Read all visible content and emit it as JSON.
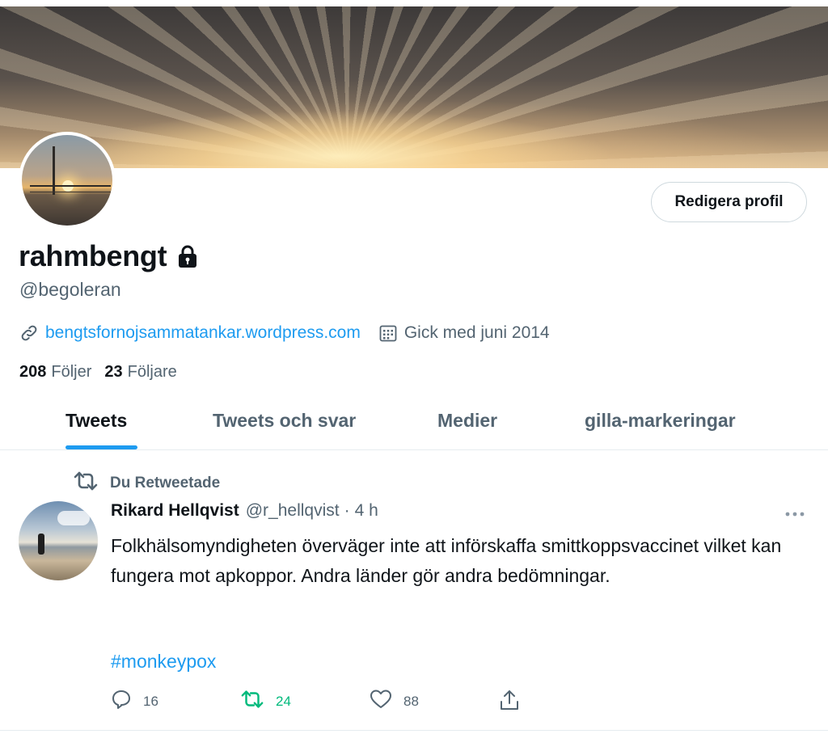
{
  "profile": {
    "display_name": "rahmbengt",
    "handle": "@begoleran",
    "website": "bengtsfornojsammatankar.wordpress.com",
    "joined": "Gick med juni 2014",
    "edit_button": "Redigera profil",
    "following_count": "208",
    "following_label": "Följer",
    "followers_count": "23",
    "followers_label": "Följare"
  },
  "tabs": [
    {
      "label": "Tweets",
      "active": true
    },
    {
      "label": "Tweets och svar",
      "active": false
    },
    {
      "label": "Medier",
      "active": false
    },
    {
      "label": "gilla-markeringar",
      "active": false
    }
  ],
  "tweet": {
    "retweet_context": "Du Retweetade",
    "author_name": "Rikard Hellqvist",
    "author_handle": "@r_hellqvist",
    "separator": "·",
    "time": "4 h",
    "text": "Folkhälsomyndigheten överväger inte att införskaffa smittkoppsvaccinet vilket kan fungera mot apkoppor. Andra länder gör andra bedömningar.",
    "hashtag": "#monkeypox",
    "replies": "16",
    "retweets": "24",
    "likes": "88"
  },
  "colors": {
    "accent": "#1d9bf0",
    "retweet_active": "#00ba7c",
    "secondary_text": "#536471"
  },
  "icons": [
    "lock-icon",
    "link-icon",
    "calendar-icon",
    "retweet-icon",
    "more-icon",
    "reply-icon",
    "like-icon",
    "share-icon"
  ]
}
